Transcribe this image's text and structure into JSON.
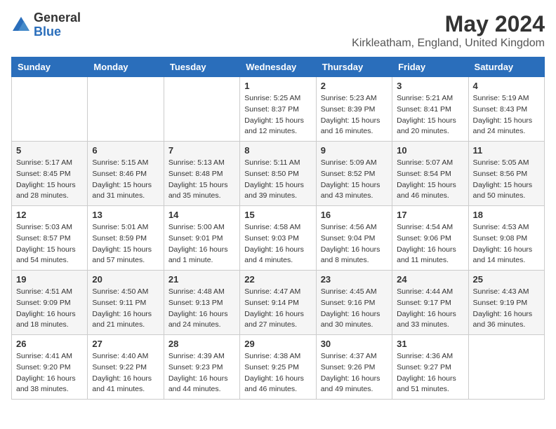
{
  "logo": {
    "general": "General",
    "blue": "Blue"
  },
  "title": "May 2024",
  "location": "Kirkleatham, England, United Kingdom",
  "headers": [
    "Sunday",
    "Monday",
    "Tuesday",
    "Wednesday",
    "Thursday",
    "Friday",
    "Saturday"
  ],
  "weeks": [
    [
      {
        "day": "",
        "info": ""
      },
      {
        "day": "",
        "info": ""
      },
      {
        "day": "",
        "info": ""
      },
      {
        "day": "1",
        "info": "Sunrise: 5:25 AM\nSunset: 8:37 PM\nDaylight: 15 hours\nand 12 minutes."
      },
      {
        "day": "2",
        "info": "Sunrise: 5:23 AM\nSunset: 8:39 PM\nDaylight: 15 hours\nand 16 minutes."
      },
      {
        "day": "3",
        "info": "Sunrise: 5:21 AM\nSunset: 8:41 PM\nDaylight: 15 hours\nand 20 minutes."
      },
      {
        "day": "4",
        "info": "Sunrise: 5:19 AM\nSunset: 8:43 PM\nDaylight: 15 hours\nand 24 minutes."
      }
    ],
    [
      {
        "day": "5",
        "info": "Sunrise: 5:17 AM\nSunset: 8:45 PM\nDaylight: 15 hours\nand 28 minutes."
      },
      {
        "day": "6",
        "info": "Sunrise: 5:15 AM\nSunset: 8:46 PM\nDaylight: 15 hours\nand 31 minutes."
      },
      {
        "day": "7",
        "info": "Sunrise: 5:13 AM\nSunset: 8:48 PM\nDaylight: 15 hours\nand 35 minutes."
      },
      {
        "day": "8",
        "info": "Sunrise: 5:11 AM\nSunset: 8:50 PM\nDaylight: 15 hours\nand 39 minutes."
      },
      {
        "day": "9",
        "info": "Sunrise: 5:09 AM\nSunset: 8:52 PM\nDaylight: 15 hours\nand 43 minutes."
      },
      {
        "day": "10",
        "info": "Sunrise: 5:07 AM\nSunset: 8:54 PM\nDaylight: 15 hours\nand 46 minutes."
      },
      {
        "day": "11",
        "info": "Sunrise: 5:05 AM\nSunset: 8:56 PM\nDaylight: 15 hours\nand 50 minutes."
      }
    ],
    [
      {
        "day": "12",
        "info": "Sunrise: 5:03 AM\nSunset: 8:57 PM\nDaylight: 15 hours\nand 54 minutes."
      },
      {
        "day": "13",
        "info": "Sunrise: 5:01 AM\nSunset: 8:59 PM\nDaylight: 15 hours\nand 57 minutes."
      },
      {
        "day": "14",
        "info": "Sunrise: 5:00 AM\nSunset: 9:01 PM\nDaylight: 16 hours\nand 1 minute."
      },
      {
        "day": "15",
        "info": "Sunrise: 4:58 AM\nSunset: 9:03 PM\nDaylight: 16 hours\nand 4 minutes."
      },
      {
        "day": "16",
        "info": "Sunrise: 4:56 AM\nSunset: 9:04 PM\nDaylight: 16 hours\nand 8 minutes."
      },
      {
        "day": "17",
        "info": "Sunrise: 4:54 AM\nSunset: 9:06 PM\nDaylight: 16 hours\nand 11 minutes."
      },
      {
        "day": "18",
        "info": "Sunrise: 4:53 AM\nSunset: 9:08 PM\nDaylight: 16 hours\nand 14 minutes."
      }
    ],
    [
      {
        "day": "19",
        "info": "Sunrise: 4:51 AM\nSunset: 9:09 PM\nDaylight: 16 hours\nand 18 minutes."
      },
      {
        "day": "20",
        "info": "Sunrise: 4:50 AM\nSunset: 9:11 PM\nDaylight: 16 hours\nand 21 minutes."
      },
      {
        "day": "21",
        "info": "Sunrise: 4:48 AM\nSunset: 9:13 PM\nDaylight: 16 hours\nand 24 minutes."
      },
      {
        "day": "22",
        "info": "Sunrise: 4:47 AM\nSunset: 9:14 PM\nDaylight: 16 hours\nand 27 minutes."
      },
      {
        "day": "23",
        "info": "Sunrise: 4:45 AM\nSunset: 9:16 PM\nDaylight: 16 hours\nand 30 minutes."
      },
      {
        "day": "24",
        "info": "Sunrise: 4:44 AM\nSunset: 9:17 PM\nDaylight: 16 hours\nand 33 minutes."
      },
      {
        "day": "25",
        "info": "Sunrise: 4:43 AM\nSunset: 9:19 PM\nDaylight: 16 hours\nand 36 minutes."
      }
    ],
    [
      {
        "day": "26",
        "info": "Sunrise: 4:41 AM\nSunset: 9:20 PM\nDaylight: 16 hours\nand 38 minutes."
      },
      {
        "day": "27",
        "info": "Sunrise: 4:40 AM\nSunset: 9:22 PM\nDaylight: 16 hours\nand 41 minutes."
      },
      {
        "day": "28",
        "info": "Sunrise: 4:39 AM\nSunset: 9:23 PM\nDaylight: 16 hours\nand 44 minutes."
      },
      {
        "day": "29",
        "info": "Sunrise: 4:38 AM\nSunset: 9:25 PM\nDaylight: 16 hours\nand 46 minutes."
      },
      {
        "day": "30",
        "info": "Sunrise: 4:37 AM\nSunset: 9:26 PM\nDaylight: 16 hours\nand 49 minutes."
      },
      {
        "day": "31",
        "info": "Sunrise: 4:36 AM\nSunset: 9:27 PM\nDaylight: 16 hours\nand 51 minutes."
      },
      {
        "day": "",
        "info": ""
      }
    ]
  ]
}
